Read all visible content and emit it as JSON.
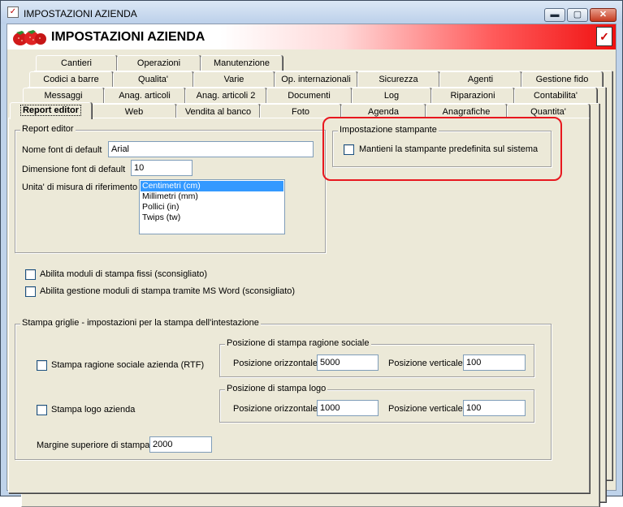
{
  "window": {
    "title": "IMPOSTAZIONI AZIENDA",
    "controls": {
      "minimize": "▬",
      "maximize": "▢",
      "close": "✕"
    }
  },
  "header": {
    "title": "IMPOSTAZIONI AZIENDA",
    "check_icon": "✓",
    "app_icon": "✓"
  },
  "tabs": {
    "row1": [
      "Cantieri",
      "Operazioni",
      "Manutenzione"
    ],
    "row2": [
      "Codici a barre",
      "Qualita'",
      "Varie",
      "Op. internazionali",
      "Sicurezza",
      "Agenti",
      "Gestione fido"
    ],
    "row3": [
      "Messaggi",
      "Anag. articoli",
      "Anag. articoli 2",
      "Documenti",
      "Log",
      "Riparazioni",
      "Contabilita'"
    ],
    "row4": [
      "Report editor",
      "Web",
      "Vendita al banco",
      "Foto",
      "Agenda",
      "Anagrafiche",
      "Quantita'"
    ]
  },
  "report_editor": {
    "group_title": "Report editor",
    "font_label": "Nome font di default",
    "font_value": "Arial",
    "size_label": "Dimensione font di default",
    "size_value": "10",
    "unit_label": "Unita' di misura di riferimento",
    "units": [
      "Centimetri (cm)",
      "Millimetri (mm)",
      "Pollici (in)",
      "Twips (tw)"
    ],
    "selected_unit": "Centimetri (cm)"
  },
  "printer": {
    "group_title": "Impostazione stampante",
    "keep_default_label": "Mantieni la stampante predefinita sul sistema",
    "keep_default_checked": false
  },
  "options": {
    "fixed_modules_label": "Abilita moduli di stampa fissi (sconsigliato)",
    "fixed_modules_checked": false,
    "word_modules_label": "Abilita gestione moduli di stampa tramite MS Word (sconsigliato)",
    "word_modules_checked": false
  },
  "grid_print": {
    "group_title": "Stampa griglie - impostazioni per la stampa dell'intestazione",
    "company_name_label": "Stampa ragione sociale azienda (RTF)",
    "company_name_checked": false,
    "company_pos": {
      "group_title": "Posizione di stampa ragione sociale",
      "h_label": "Posizione orizzontale",
      "h_value": "5000",
      "v_label": "Posizione verticale",
      "v_value": "100"
    },
    "logo_label": "Stampa logo azienda",
    "logo_checked": false,
    "logo_pos": {
      "group_title": "Posizione di stampa logo",
      "h_label": "Posizione orizzontale",
      "h_value": "1000",
      "v_label": "Posizione verticale",
      "v_value": "100"
    },
    "top_margin_label": "Margine superiore di stampa",
    "top_margin_value": "2000"
  },
  "colors": {
    "highlight_box": "#e8171e",
    "selection": "#3399ff",
    "header_red": "#f01010"
  }
}
